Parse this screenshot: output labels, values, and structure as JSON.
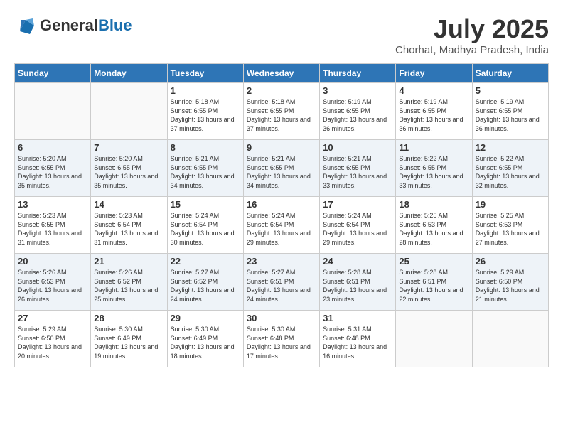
{
  "header": {
    "logo_general": "General",
    "logo_blue": "Blue",
    "month_year": "July 2025",
    "location": "Chorhat, Madhya Pradesh, India"
  },
  "weekdays": [
    "Sunday",
    "Monday",
    "Tuesday",
    "Wednesday",
    "Thursday",
    "Friday",
    "Saturday"
  ],
  "weeks": [
    [
      {
        "day": "",
        "sunrise": "",
        "sunset": "",
        "daylight": ""
      },
      {
        "day": "",
        "sunrise": "",
        "sunset": "",
        "daylight": ""
      },
      {
        "day": "1",
        "sunrise": "Sunrise: 5:18 AM",
        "sunset": "Sunset: 6:55 PM",
        "daylight": "Daylight: 13 hours and 37 minutes."
      },
      {
        "day": "2",
        "sunrise": "Sunrise: 5:18 AM",
        "sunset": "Sunset: 6:55 PM",
        "daylight": "Daylight: 13 hours and 37 minutes."
      },
      {
        "day": "3",
        "sunrise": "Sunrise: 5:19 AM",
        "sunset": "Sunset: 6:55 PM",
        "daylight": "Daylight: 13 hours and 36 minutes."
      },
      {
        "day": "4",
        "sunrise": "Sunrise: 5:19 AM",
        "sunset": "Sunset: 6:55 PM",
        "daylight": "Daylight: 13 hours and 36 minutes."
      },
      {
        "day": "5",
        "sunrise": "Sunrise: 5:19 AM",
        "sunset": "Sunset: 6:55 PM",
        "daylight": "Daylight: 13 hours and 36 minutes."
      }
    ],
    [
      {
        "day": "6",
        "sunrise": "Sunrise: 5:20 AM",
        "sunset": "Sunset: 6:55 PM",
        "daylight": "Daylight: 13 hours and 35 minutes."
      },
      {
        "day": "7",
        "sunrise": "Sunrise: 5:20 AM",
        "sunset": "Sunset: 6:55 PM",
        "daylight": "Daylight: 13 hours and 35 minutes."
      },
      {
        "day": "8",
        "sunrise": "Sunrise: 5:21 AM",
        "sunset": "Sunset: 6:55 PM",
        "daylight": "Daylight: 13 hours and 34 minutes."
      },
      {
        "day": "9",
        "sunrise": "Sunrise: 5:21 AM",
        "sunset": "Sunset: 6:55 PM",
        "daylight": "Daylight: 13 hours and 34 minutes."
      },
      {
        "day": "10",
        "sunrise": "Sunrise: 5:21 AM",
        "sunset": "Sunset: 6:55 PM",
        "daylight": "Daylight: 13 hours and 33 minutes."
      },
      {
        "day": "11",
        "sunrise": "Sunrise: 5:22 AM",
        "sunset": "Sunset: 6:55 PM",
        "daylight": "Daylight: 13 hours and 33 minutes."
      },
      {
        "day": "12",
        "sunrise": "Sunrise: 5:22 AM",
        "sunset": "Sunset: 6:55 PM",
        "daylight": "Daylight: 13 hours and 32 minutes."
      }
    ],
    [
      {
        "day": "13",
        "sunrise": "Sunrise: 5:23 AM",
        "sunset": "Sunset: 6:55 PM",
        "daylight": "Daylight: 13 hours and 31 minutes."
      },
      {
        "day": "14",
        "sunrise": "Sunrise: 5:23 AM",
        "sunset": "Sunset: 6:54 PM",
        "daylight": "Daylight: 13 hours and 31 minutes."
      },
      {
        "day": "15",
        "sunrise": "Sunrise: 5:24 AM",
        "sunset": "Sunset: 6:54 PM",
        "daylight": "Daylight: 13 hours and 30 minutes."
      },
      {
        "day": "16",
        "sunrise": "Sunrise: 5:24 AM",
        "sunset": "Sunset: 6:54 PM",
        "daylight": "Daylight: 13 hours and 29 minutes."
      },
      {
        "day": "17",
        "sunrise": "Sunrise: 5:24 AM",
        "sunset": "Sunset: 6:54 PM",
        "daylight": "Daylight: 13 hours and 29 minutes."
      },
      {
        "day": "18",
        "sunrise": "Sunrise: 5:25 AM",
        "sunset": "Sunset: 6:53 PM",
        "daylight": "Daylight: 13 hours and 28 minutes."
      },
      {
        "day": "19",
        "sunrise": "Sunrise: 5:25 AM",
        "sunset": "Sunset: 6:53 PM",
        "daylight": "Daylight: 13 hours and 27 minutes."
      }
    ],
    [
      {
        "day": "20",
        "sunrise": "Sunrise: 5:26 AM",
        "sunset": "Sunset: 6:53 PM",
        "daylight": "Daylight: 13 hours and 26 minutes."
      },
      {
        "day": "21",
        "sunrise": "Sunrise: 5:26 AM",
        "sunset": "Sunset: 6:52 PM",
        "daylight": "Daylight: 13 hours and 25 minutes."
      },
      {
        "day": "22",
        "sunrise": "Sunrise: 5:27 AM",
        "sunset": "Sunset: 6:52 PM",
        "daylight": "Daylight: 13 hours and 24 minutes."
      },
      {
        "day": "23",
        "sunrise": "Sunrise: 5:27 AM",
        "sunset": "Sunset: 6:51 PM",
        "daylight": "Daylight: 13 hours and 24 minutes."
      },
      {
        "day": "24",
        "sunrise": "Sunrise: 5:28 AM",
        "sunset": "Sunset: 6:51 PM",
        "daylight": "Daylight: 13 hours and 23 minutes."
      },
      {
        "day": "25",
        "sunrise": "Sunrise: 5:28 AM",
        "sunset": "Sunset: 6:51 PM",
        "daylight": "Daylight: 13 hours and 22 minutes."
      },
      {
        "day": "26",
        "sunrise": "Sunrise: 5:29 AM",
        "sunset": "Sunset: 6:50 PM",
        "daylight": "Daylight: 13 hours and 21 minutes."
      }
    ],
    [
      {
        "day": "27",
        "sunrise": "Sunrise: 5:29 AM",
        "sunset": "Sunset: 6:50 PM",
        "daylight": "Daylight: 13 hours and 20 minutes."
      },
      {
        "day": "28",
        "sunrise": "Sunrise: 5:30 AM",
        "sunset": "Sunset: 6:49 PM",
        "daylight": "Daylight: 13 hours and 19 minutes."
      },
      {
        "day": "29",
        "sunrise": "Sunrise: 5:30 AM",
        "sunset": "Sunset: 6:49 PM",
        "daylight": "Daylight: 13 hours and 18 minutes."
      },
      {
        "day": "30",
        "sunrise": "Sunrise: 5:30 AM",
        "sunset": "Sunset: 6:48 PM",
        "daylight": "Daylight: 13 hours and 17 minutes."
      },
      {
        "day": "31",
        "sunrise": "Sunrise: 5:31 AM",
        "sunset": "Sunset: 6:48 PM",
        "daylight": "Daylight: 13 hours and 16 minutes."
      },
      {
        "day": "",
        "sunrise": "",
        "sunset": "",
        "daylight": ""
      },
      {
        "day": "",
        "sunrise": "",
        "sunset": "",
        "daylight": ""
      }
    ]
  ]
}
